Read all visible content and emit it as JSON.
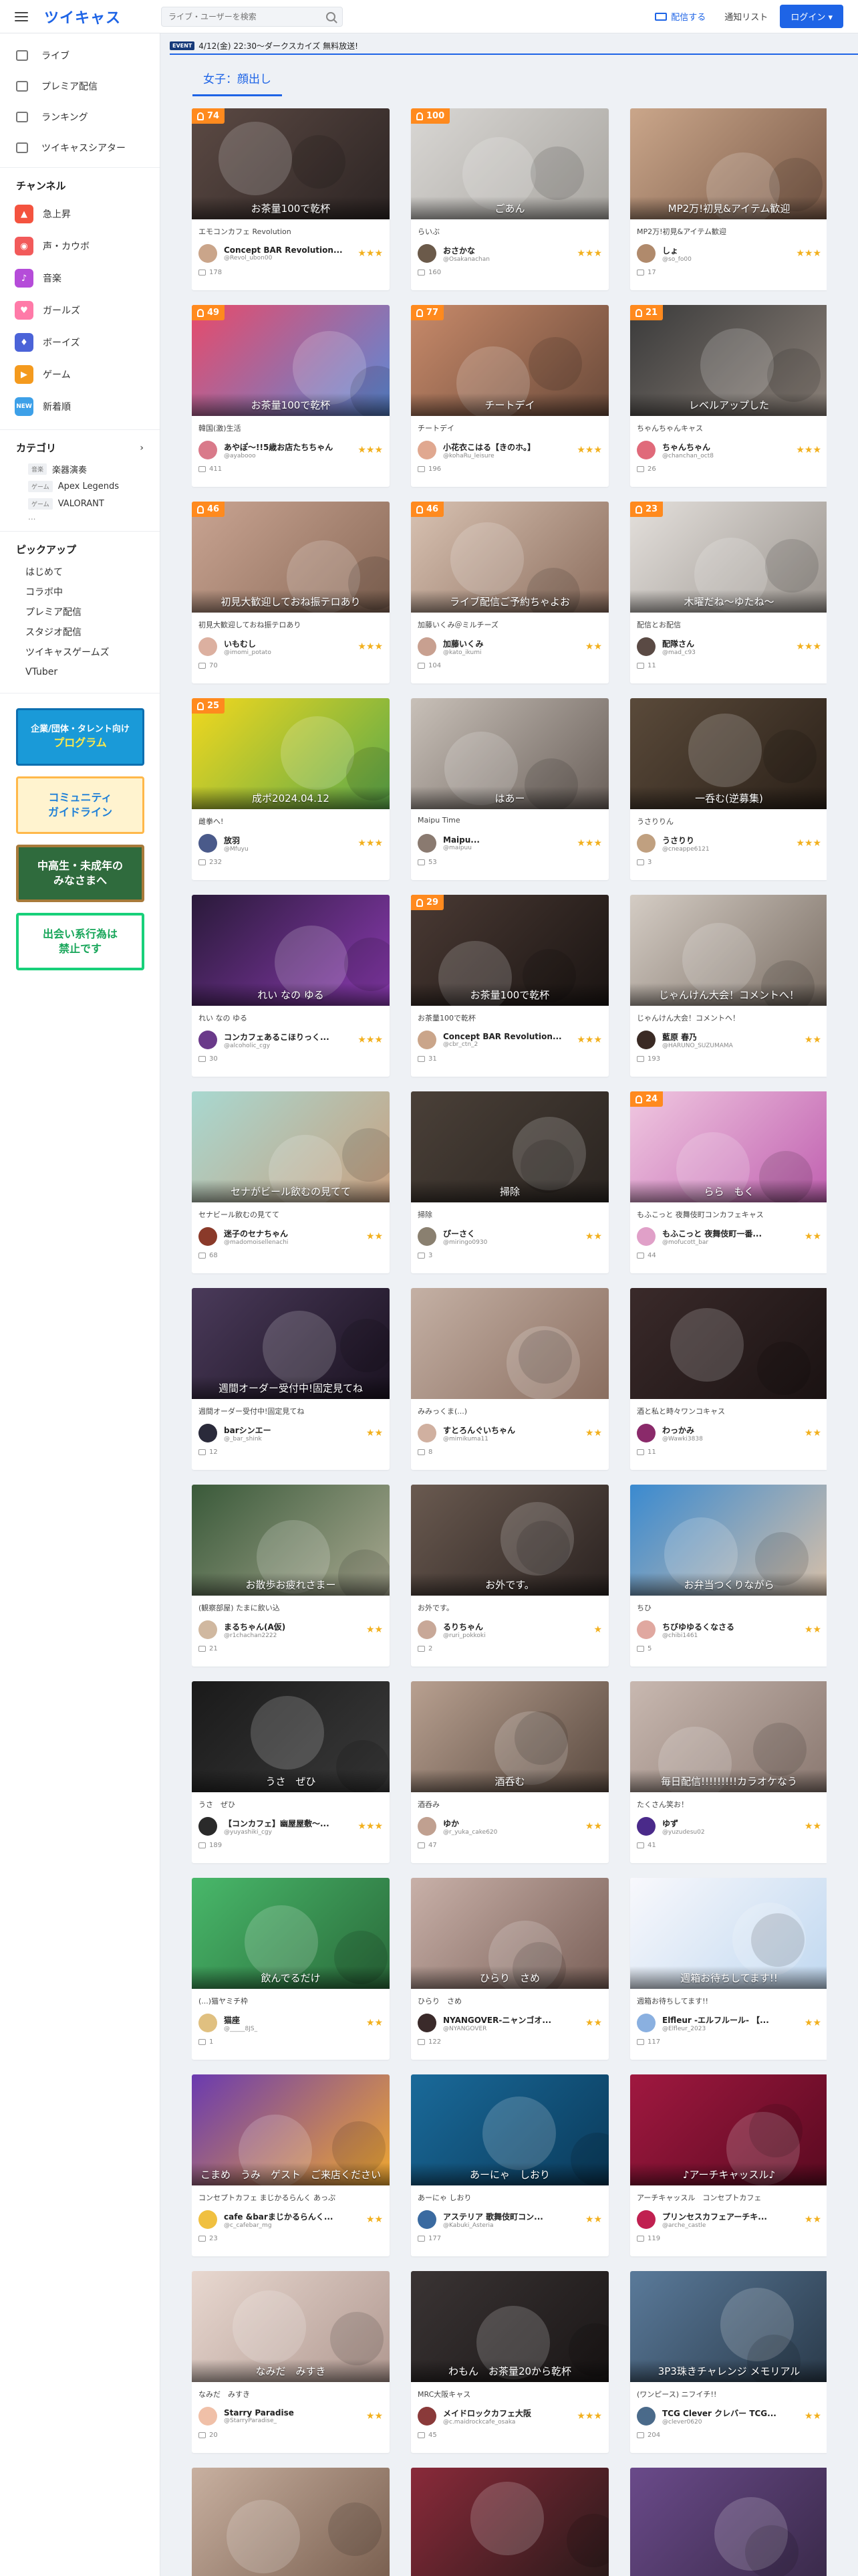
{
  "header": {
    "logo": "ツイキャス",
    "search_placeholder": "ライブ・ユーザーを検索",
    "broadcast_label": "配信する",
    "notify_label": "通知リスト",
    "login_label": "ログイン"
  },
  "sidebar": {
    "nav": [
      {
        "label": "ライブ"
      },
      {
        "label": "プレミア配信"
      },
      {
        "label": "ランキング"
      },
      {
        "label": "ツイキャスシアター"
      }
    ],
    "channel_title": "チャンネル",
    "channels": [
      {
        "label": "急上昇",
        "color": "#f4533f",
        "glyph": "▲"
      },
      {
        "label": "声・カウボ",
        "color": "#f25a5a",
        "glyph": "◉"
      },
      {
        "label": "音楽",
        "color": "#b54cd9",
        "glyph": "♪"
      },
      {
        "label": "ガールズ",
        "color": "#ff7aa8",
        "glyph": "♥"
      },
      {
        "label": "ボーイズ",
        "color": "#4b63d8",
        "glyph": "♦"
      },
      {
        "label": "ゲーム",
        "color": "#f49a1e",
        "glyph": "▶"
      },
      {
        "label": "新着順",
        "color": "#3da0e8",
        "glyph": "NEW"
      }
    ],
    "category_title": "カテゴリ",
    "categories": [
      {
        "tag": "音楽",
        "label": "楽器演奏"
      },
      {
        "tag": "ゲーム",
        "label": "Apex Legends"
      },
      {
        "tag": "ゲーム",
        "label": "VALORANT"
      }
    ],
    "category_more": "...",
    "pickup_title": "ピックアップ",
    "pickups": [
      {
        "label": "はじめて"
      },
      {
        "label": "コラボ中"
      },
      {
        "label": "プレミア配信"
      },
      {
        "label": "スタジオ配信"
      },
      {
        "label": "ツイキャスゲームズ"
      },
      {
        "label": "VTuber"
      }
    ],
    "banners": {
      "b1_line1": "企業/団体・タレント向け",
      "b1_line2": "プログラム",
      "b2_line1": "コミュニティ",
      "b2_line2": "ガイドライン",
      "b3_line1": "中高生・未成年の",
      "b3_line2": "みなさまへ",
      "b4_line1": "出会い系行為は",
      "b4_line2": "禁止です"
    }
  },
  "event": {
    "tag": "EVENT",
    "text": "4/12(金) 22:30～ダークスカイズ 無料放送!"
  },
  "tab_label": "女子：顔出し",
  "cards": [
    {
      "viewers": "74",
      "caption": "お茶量100で乾杯",
      "sub": "エモコンカフェ Revolution",
      "name": "Concept BAR Revolution...",
      "uid": "@Revol_ubon00",
      "stars": "★★★",
      "comments": "178",
      "bg": [
        "#5c4a44",
        "#2c2423"
      ],
      "av": "#caa58a"
    },
    {
      "viewers": "100",
      "caption": "ごあん",
      "sub": "らいぶ",
      "name": "おさかな",
      "uid": "@Osakanachan",
      "stars": "★★★",
      "comments": "160",
      "bg": [
        "#d9d7d4",
        "#a8a5a0"
      ],
      "av": "#6b5a4a"
    },
    {
      "viewers": "",
      "caption": "MP2万!初見&アイテム歓迎",
      "sub": "MP2万!初見&アイテム歓迎",
      "name": "しょ",
      "uid": "@so_fo00",
      "stars": "★★★",
      "comments": "17",
      "bg": [
        "#caa68a",
        "#7a5a48"
      ],
      "av": "#b08a6c"
    },
    {
      "viewers": "49",
      "caption": "お茶量100で乾杯",
      "sub": "韓国(激)生活",
      "name": "あやぽ～!!5歳お店たちちゃん",
      "uid": "@ayabooo",
      "stars": "★★★",
      "comments": "411",
      "bg": [
        "#e84a6a",
        "#5a8ad8"
      ],
      "av": "#d97a8a"
    },
    {
      "viewers": "77",
      "caption": "チートデイ",
      "sub": "チートデイ",
      "name": "小花衣こはる【きのホ。】",
      "uid": "@kohaRu_leisure",
      "stars": "★★★",
      "comments": "196",
      "bg": [
        "#c88a6a",
        "#6a4a3a"
      ],
      "av": "#e0a890"
    },
    {
      "viewers": "21",
      "caption": "レベルアップした",
      "sub": "ちゃんちゃんキャス",
      "name": "ちゃんちゃん",
      "uid": "@chanchan_oct8",
      "stars": "★★★",
      "comments": "26",
      "bg": [
        "#3a3a3a",
        "#8a8078"
      ],
      "av": "#e06a7a"
    },
    {
      "viewers": "46",
      "caption": "初見大歓迎しておね振テロあり",
      "sub": "初見大歓迎しておね振テロあり",
      "name": "いもむし",
      "uid": "@imomi_potato",
      "stars": "★★★",
      "comments": "70",
      "bg": [
        "#c9a492",
        "#8a6a58"
      ],
      "av": "#dcb0a0"
    },
    {
      "viewers": "46",
      "caption": "ライブ配信ご予約ちゃよお",
      "sub": "加藤いくみ＠ミルチーズ",
      "name": "加藤いくみ",
      "uid": "@kato_ikumi",
      "stars": "★★",
      "comments": "104",
      "bg": [
        "#d8c2b2",
        "#8c6e5e"
      ],
      "av": "#c8a090"
    },
    {
      "viewers": "23",
      "caption": "木曜だね〜ゆたね〜",
      "sub": "配信とお配信",
      "name": "配隊さん",
      "uid": "@mad_c93",
      "stars": "★★★",
      "comments": "11",
      "bg": [
        "#e4e0dc",
        "#9a948e"
      ],
      "av": "#5a4a44"
    },
    {
      "viewers": "25",
      "caption": "成ポ2024.04.12",
      "sub": "雌拳へ!",
      "name": "放羽",
      "uid": "@Mfuyu",
      "stars": "★★★",
      "comments": "232",
      "bg": [
        "#f2d81e",
        "#5aa84a"
      ],
      "av": "#4a5a8a"
    },
    {
      "viewers": "",
      "caption": "はあー",
      "sub": "Maipu Time",
      "name": "Maipu...",
      "uid": "@maipuu",
      "stars": "★★★",
      "comments": "53",
      "bg": [
        "#c8c0b8",
        "#6a605a"
      ],
      "av": "#8a7a70"
    },
    {
      "viewers": "",
      "caption": "一呑む(逆募集)",
      "sub": "うさりりん",
      "name": "うさりり",
      "uid": "@cneappe6121",
      "stars": "★★★",
      "comments": "3",
      "bg": [
        "#5a4a3a",
        "#2a2018"
      ],
      "av": "#c0a080"
    },
    {
      "viewers": "",
      "caption": "れい なの ゆる",
      "sub": "れい なの ゆる",
      "name": "コンカフェあるこほりっく...",
      "uid": "@alcoholic_cgy",
      "stars": "★★★",
      "comments": "30",
      "bg": [
        "#2a1a3a",
        "#8a3ab0"
      ],
      "av": "#6a3a8a"
    },
    {
      "viewers": "29",
      "caption": "お茶量100で乾杯",
      "sub": "お茶量100で乾杯",
      "name": "Concept BAR Revolution...",
      "uid": "@cbr_ctn_2",
      "stars": "★★★",
      "comments": "31",
      "bg": [
        "#4a3a34",
        "#1a1412"
      ],
      "av": "#caa58a"
    },
    {
      "viewers": "",
      "caption": "じゃんけん大会！コメントへ！",
      "sub": "じゃんけん大会！コメントへ！",
      "name": "藍原 春乃",
      "uid": "@HARUNO_SUZUMAMA",
      "stars": "★★",
      "comments": "193",
      "bg": [
        "#d4ccc4",
        "#7a6e64"
      ],
      "av": "#3a2a24"
    },
    {
      "viewers": "",
      "caption": "セナがビール飲むの見てて",
      "sub": "セナビール飲むの見てて",
      "name": "迷子のセナちゃん",
      "uid": "@madomoisellenachi",
      "stars": "★★",
      "comments": "68",
      "bg": [
        "#a8d8d0",
        "#c8a080"
      ],
      "av": "#8a3a2a"
    },
    {
      "viewers": "",
      "caption": "掃除",
      "sub": "掃除",
      "name": "ぴーさく",
      "uid": "@miringo0930",
      "stars": "★★",
      "comments": "3",
      "bg": [
        "#4a4038",
        "#2a2420"
      ],
      "av": "#8a8070"
    },
    {
      "viewers": "24",
      "caption": "らら　もく",
      "sub": "もふこっと 夜舞伎町コンカフェキャス",
      "name": "もふこっと 夜舞伎町一番...",
      "uid": "@mofucott_bar",
      "stars": "★★",
      "comments": "44",
      "bg": [
        "#f0c8e0",
        "#c060b0"
      ],
      "av": "#e0a0c8"
    },
    {
      "viewers": "",
      "caption": "週間オーダー受付中!固定見てね",
      "sub": "週間オーダー受付中!固定見てね",
      "name": "barシンエー",
      "uid": "@_bar_shink",
      "stars": "★★",
      "comments": "12",
      "bg": [
        "#4a3a5a",
        "#1a1220"
      ],
      "av": "#2a2a3a"
    },
    {
      "viewers": "",
      "caption": "",
      "sub": "みみっくま(...)",
      "name": "すとろんぐいちゃん",
      "uid": "@mimikuma11",
      "stars": "★★",
      "comments": "8",
      "bg": [
        "#c4b0a4",
        "#8a6e60"
      ],
      "av": "#d0b0a0"
    },
    {
      "viewers": "",
      "caption": "",
      "sub": "酒と私と時々ワンコキャス",
      "name": "わっかみ",
      "uid": "@Wawki3838",
      "stars": "★★",
      "comments": "11",
      "bg": [
        "#3a2a2a",
        "#1a1212"
      ],
      "av": "#8a2a6a"
    },
    {
      "viewers": "",
      "caption": "お散歩お疲れさまー",
      "sub": "(観察部屋) たまに飲い込",
      "name": "まるちゃん(A仮)",
      "uid": "@r1chachan2222",
      "stars": "★★",
      "comments": "21",
      "bg": [
        "#3a5a3a",
        "#a8a890"
      ],
      "av": "#d0b8a0"
    },
    {
      "viewers": "",
      "caption": "お外です。",
      "sub": "お外です。",
      "name": "るりちゃん",
      "uid": "@ruri_pokkoki",
      "stars": "★",
      "comments": "2",
      "bg": [
        "#6a5a50",
        "#2a2220"
      ],
      "av": "#c8a898"
    },
    {
      "viewers": "",
      "caption": "お弁当つくりながら",
      "sub": "ちひ",
      "name": "ちびゆゆるくなさる",
      "uid": "@chibi1461",
      "stars": "★★",
      "comments": "5",
      "bg": [
        "#3a8ad0",
        "#d8c0a8"
      ],
      "av": "#e0a8a0"
    },
    {
      "viewers": "",
      "caption": "うさ　ぜひ",
      "sub": "うさ　ぜひ",
      "name": "【コンカフェ】幽屋屋敷～...",
      "uid": "@yuyashiki_cgy",
      "stars": "★★★",
      "comments": "189",
      "bg": [
        "#1a1a1a",
        "#3a3a3a"
      ],
      "av": "#2a2a2a"
    },
    {
      "viewers": "",
      "caption": "酒呑む",
      "sub": "酒呑み",
      "name": "ゆか",
      "uid": "@r_yuka_cake620",
      "stars": "★★",
      "comments": "47",
      "bg": [
        "#b8a090",
        "#5a4a40"
      ],
      "av": "#c0a090"
    },
    {
      "viewers": "",
      "caption": "毎日配信!!!!!!!!!カラオケなう",
      "sub": "たくさん笑お！",
      "name": "ゆず",
      "uid": "@yuzudesu02",
      "stars": "★★",
      "comments": "41",
      "bg": [
        "#c8b8b0",
        "#8a7870"
      ],
      "av": "#4a2a8a"
    },
    {
      "viewers": "",
      "caption": "飲んでるだけ",
      "sub": "(...)猫ヤミチ枠",
      "name": "猫座",
      "uid": "@_____8JS_",
      "stars": "★★",
      "comments": "1",
      "bg": [
        "#48b86a",
        "#2a6a3a"
      ],
      "av": "#e0c080"
    },
    {
      "viewers": "",
      "caption": "ひらり　さめ",
      "sub": "ひらり　さめ",
      "name": "NYANGOVER-ニャンゴオ...",
      "uid": "@NYANGOVER",
      "stars": "★★",
      "comments": "122",
      "bg": [
        "#c8b0a8",
        "#7a6058"
      ],
      "av": "#3a2a2a"
    },
    {
      "viewers": "",
      "caption": "週箱お待ちしてます!!",
      "sub": "週箱お待ちしてます!!",
      "name": "Elfleur -エルフルール- 【...",
      "uid": "@Elfleur_2023",
      "stars": "★★",
      "comments": "117",
      "bg": [
        "#f8f8fc",
        "#c0d8f0"
      ],
      "av": "#8ab0e0"
    },
    {
      "viewers": "",
      "caption": "こまめ　うみ　ゲスト　ご来店ください",
      "sub": "コンセプトカフェ まじかるらんく あっぷ",
      "name": "cafe &barまじかるらんく...",
      "uid": "@c_cafebar_mg",
      "stars": "★★",
      "comments": "23",
      "bg": [
        "#6a3ab0",
        "#f0a830"
      ],
      "av": "#f0c040"
    },
    {
      "viewers": "",
      "caption": "あーにゃ　しおり",
      "sub": "あーにゃ しおり",
      "name": "アステリア 歌舞伎町コン...",
      "uid": "@Kabuki_Asteria",
      "stars": "★★",
      "comments": "177",
      "bg": [
        "#1a6a9a",
        "#0a3a5a"
      ],
      "av": "#3a6aa0"
    },
    {
      "viewers": "",
      "caption": "♪アーチキャッスル♪",
      "sub": "アーチキャッスル　コンセプトカフェ",
      "name": "プリンセスカフェアーチキ...",
      "uid": "@arche_castle",
      "stars": "★★",
      "comments": "119",
      "bg": [
        "#a01840",
        "#5a0a20"
      ],
      "av": "#c02050"
    },
    {
      "viewers": "",
      "caption": "なみだ　みすき",
      "sub": "なみだ　みすき",
      "name": "Starry Paradise",
      "uid": "@StarryParadise_",
      "stars": "★★",
      "comments": "20",
      "bg": [
        "#e8d8d0",
        "#b09890"
      ],
      "av": "#f0c0a8"
    },
    {
      "viewers": "",
      "caption": "わもん　お茶量20から乾杯",
      "sub": "MRC大阪キャス",
      "name": "メイドロックカフェ大阪",
      "uid": "@c.maidrockcafe_osaka",
      "stars": "★★★",
      "comments": "45",
      "bg": [
        "#3a3434",
        "#1a1616"
      ],
      "av": "#8a3a3a"
    },
    {
      "viewers": "",
      "caption": "3P3珠きチャレンジ メモリアル",
      "sub": "(ワンピース) ニフイチ!!",
      "name": "TCG Clever クレバー TCG...",
      "uid": "@clever0620",
      "stars": "★★",
      "comments": "204",
      "bg": [
        "#5a7a9a",
        "#2a3a4a"
      ],
      "av": "#4a6a8a"
    },
    {
      "viewers": "",
      "caption": "",
      "sub": "",
      "name": "",
      "uid": "",
      "stars": "",
      "comments": "",
      "bg": [
        "#c8b0a0",
        "#7a6050"
      ],
      "av": "#c0a090"
    },
    {
      "viewers": "",
      "caption": "",
      "sub": "",
      "name": "",
      "uid": "",
      "stars": "",
      "comments": "",
      "bg": [
        "#8a2a3a",
        "#2a1a1a"
      ],
      "av": "#c0a090"
    },
    {
      "viewers": "",
      "caption": "",
      "sub": "",
      "name": "",
      "uid": "",
      "stars": "",
      "comments": "",
      "bg": [
        "#6a4a8a",
        "#3a2a4a"
      ],
      "av": "#c0a090"
    }
  ]
}
